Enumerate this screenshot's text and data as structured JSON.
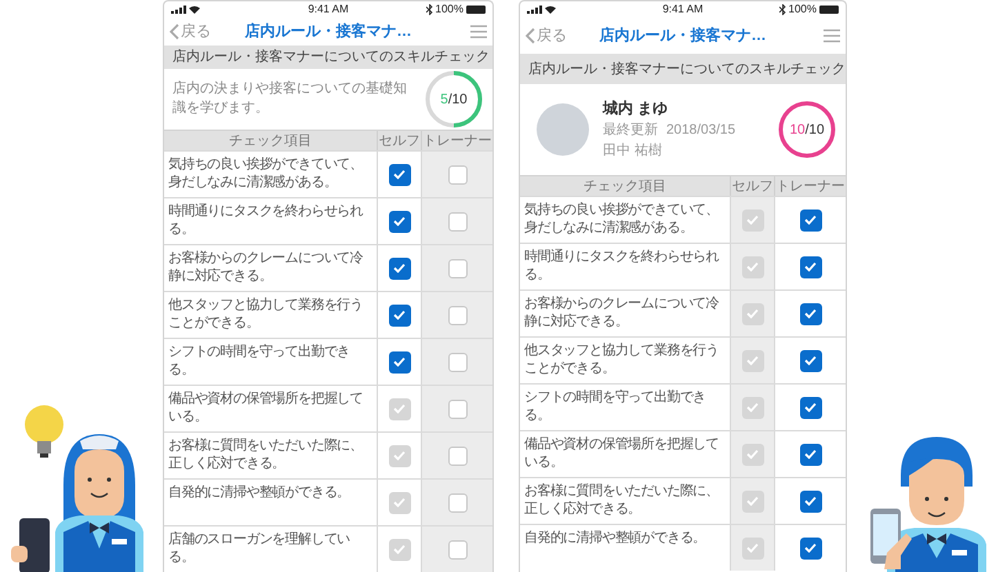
{
  "phones": [
    {
      "status": {
        "time": "9:41 AM",
        "battery": "100%"
      },
      "nav": {
        "back": "戻る",
        "title": "店内ルール・接客マナ…"
      },
      "section_title": "店内ルール・接客マナーについてのスキルチェック",
      "summary": {
        "kind": "description",
        "text": "店内の決まりや接客についての基礎知識を学びます。",
        "progress": {
          "count": "5",
          "total": "/10",
          "level": 0.5,
          "color": "#3cc47c"
        }
      },
      "columns": [
        {
          "label": "チェック項目"
        },
        {
          "label": "セルフ",
          "disabled": false
        },
        {
          "label": "トレーナー",
          "disabled": true
        }
      ],
      "rows": [
        {
          "text": "気持ちの良い挨拶ができていて、身だしなみに清潔感がある。",
          "self": {
            "checked": true,
            "disabled": false
          },
          "trainer": {
            "checked": false,
            "disabled": false
          }
        },
        {
          "text": "時間通りにタスクを終わらせられる。",
          "self": {
            "checked": true,
            "disabled": false
          },
          "trainer": {
            "checked": false,
            "disabled": false
          }
        },
        {
          "text": "お客様からのクレームについて冷静に対応できる。",
          "self": {
            "checked": true,
            "disabled": false
          },
          "trainer": {
            "checked": false,
            "disabled": false
          }
        },
        {
          "text": "他スタッフと協力して業務を行うことができる。",
          "self": {
            "checked": true,
            "disabled": false
          },
          "trainer": {
            "checked": false,
            "disabled": false
          }
        },
        {
          "text": "シフトの時間を守って出勤できる。",
          "self": {
            "checked": true,
            "disabled": false
          },
          "trainer": {
            "checked": false,
            "disabled": false
          }
        },
        {
          "text": "備品や資材の保管場所を把握している。",
          "self": {
            "checked": true,
            "disabled": true
          },
          "trainer": {
            "checked": false,
            "disabled": false
          }
        },
        {
          "text": "お客様に質問をいただいた際に、正しく応対できる。",
          "self": {
            "checked": true,
            "disabled": true
          },
          "trainer": {
            "checked": false,
            "disabled": false
          }
        },
        {
          "text": "自発的に清掃や整頓ができる。",
          "self": {
            "checked": true,
            "disabled": true
          },
          "trainer": {
            "checked": false,
            "disabled": false
          }
        },
        {
          "text": "店舗のスローガンを理解している。",
          "self": {
            "checked": true,
            "disabled": true
          },
          "trainer": {
            "checked": false,
            "disabled": false
          }
        }
      ]
    },
    {
      "status": {
        "time": "9:41 AM",
        "battery": "100%"
      },
      "nav": {
        "back": "戻る",
        "title": "店内ルール・接客マナ…"
      },
      "section_title": "店内ルール・接客マナーについてのスキルチェック",
      "summary": {
        "kind": "profile",
        "name": "城内 まゆ",
        "updated_label": "最終更新",
        "updated_date": "2018/03/15",
        "trainer": "田中 祐樹",
        "progress": {
          "count": "10",
          "total": "/10",
          "level": 1,
          "color": "#e8418f"
        }
      },
      "columns": [
        {
          "label": "チェック項目"
        },
        {
          "label": "セルフ",
          "disabled": true
        },
        {
          "label": "トレーナー",
          "disabled": false
        }
      ],
      "rows": [
        {
          "text": "気持ちの良い挨拶ができていて、身だしなみに清潔感がある。",
          "self": {
            "checked": true,
            "disabled": true
          },
          "trainer": {
            "checked": true,
            "disabled": false
          }
        },
        {
          "text": "時間通りにタスクを終わらせられる。",
          "self": {
            "checked": true,
            "disabled": true
          },
          "trainer": {
            "checked": true,
            "disabled": false
          }
        },
        {
          "text": "お客様からのクレームについて冷静に対応できる。",
          "self": {
            "checked": true,
            "disabled": true
          },
          "trainer": {
            "checked": true,
            "disabled": false
          }
        },
        {
          "text": "他スタッフと協力して業務を行うことができる。",
          "self": {
            "checked": true,
            "disabled": true
          },
          "trainer": {
            "checked": true,
            "disabled": false
          }
        },
        {
          "text": "シフトの時間を守って出勤できる。",
          "self": {
            "checked": true,
            "disabled": true
          },
          "trainer": {
            "checked": true,
            "disabled": false
          }
        },
        {
          "text": "備品や資材の保管場所を把握している。",
          "self": {
            "checked": true,
            "disabled": true
          },
          "trainer": {
            "checked": true,
            "disabled": false
          }
        },
        {
          "text": "お客様に質問をいただいた際に、正しく応対できる。",
          "self": {
            "checked": true,
            "disabled": true
          },
          "trainer": {
            "checked": true,
            "disabled": false
          }
        },
        {
          "text": "自発的に清掃や整頓ができる。",
          "self": {
            "checked": true,
            "disabled": true
          },
          "trainer": {
            "checked": true,
            "disabled": false
          }
        }
      ]
    }
  ]
}
